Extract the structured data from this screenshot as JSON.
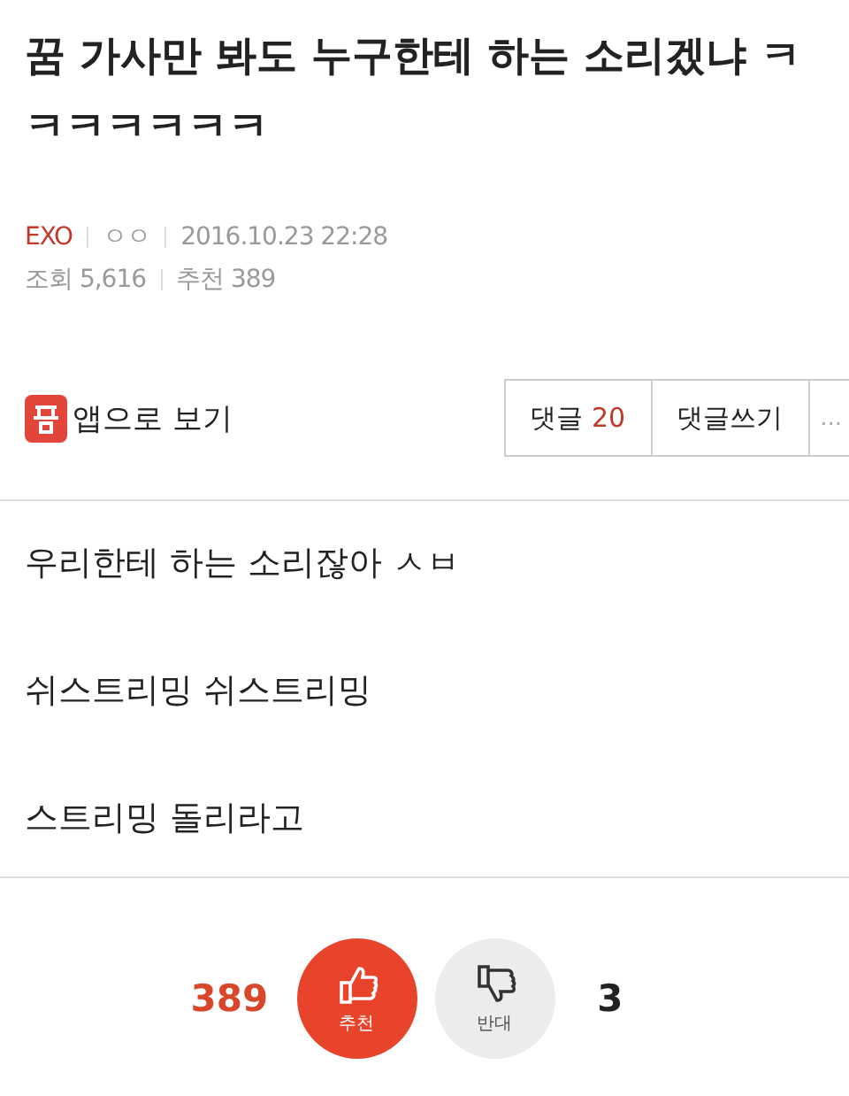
{
  "post": {
    "title": "꿈 가사만 봐도 누구한테 하는 소리겠냐 ㅋㅋㅋㅋㅋㅋㅋ",
    "board": "EXO",
    "author": "ㅇㅇ",
    "date": "2016.10.23 22:28",
    "views": "조회 5,616",
    "recommends": "추천 389"
  },
  "toolbar": {
    "app_link": "앱으로 보기",
    "comments_label": "댓글",
    "comments_count": "20",
    "write_comment": "댓글쓰기",
    "more": "..."
  },
  "body": [
    "우리한테 하는 소리잖아 ㅅㅂ",
    "쉬스트리밍 쉬스트리밍",
    "스트리밍 돌리라고"
  ],
  "votes": {
    "up_count": "389",
    "up_label": "추천",
    "down_label": "반대",
    "down_count": "3"
  }
}
